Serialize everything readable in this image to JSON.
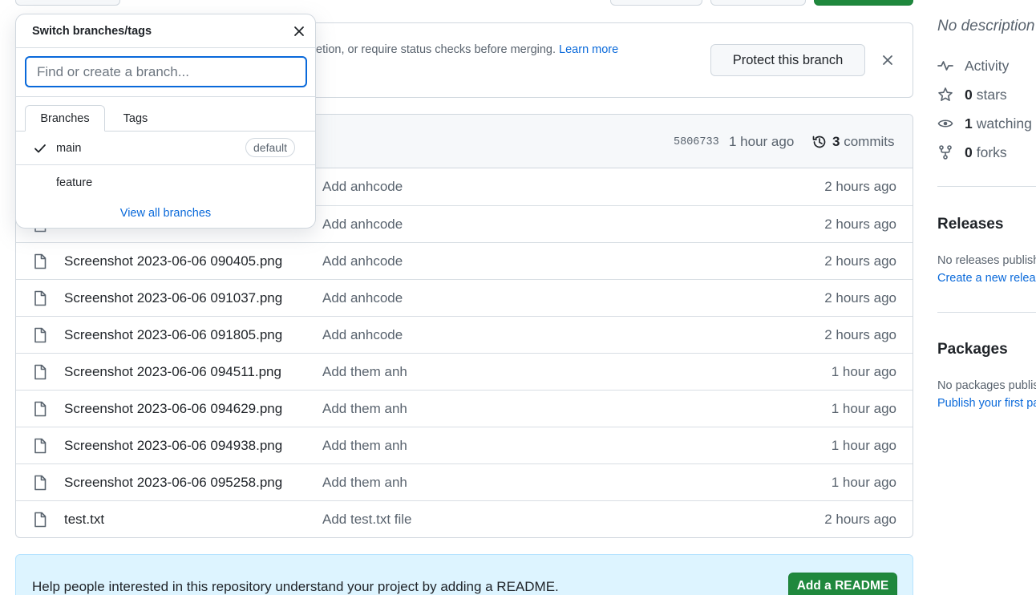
{
  "branch_popup": {
    "title": "Switch branches/tags",
    "search_placeholder": "Find or create a branch...",
    "tabs": [
      {
        "label": "Branches",
        "active": true
      },
      {
        "label": "Tags",
        "active": false
      }
    ],
    "branches": [
      {
        "name": "main",
        "selected": true,
        "badge": "default"
      },
      {
        "name": "feature",
        "selected": false,
        "badge": ""
      }
    ],
    "view_all_label": "View all branches"
  },
  "protect_banner": {
    "text": "etion, or require status checks before merging.",
    "learn_more": "Learn more",
    "button_label": "Protect this branch"
  },
  "latest_commit": {
    "sha": "5806733",
    "time": "1 hour ago",
    "commit_count": "3",
    "commits_label": "commits"
  },
  "files": [
    {
      "name": "",
      "message": "Add anhcode",
      "time": "2 hours ago"
    },
    {
      "name": "",
      "message": "Add anhcode",
      "time": "2 hours ago"
    },
    {
      "name": "Screenshot 2023-06-06 090405.png",
      "message": "Add anhcode",
      "time": "2 hours ago"
    },
    {
      "name": "Screenshot 2023-06-06 091037.png",
      "message": "Add anhcode",
      "time": "2 hours ago"
    },
    {
      "name": "Screenshot 2023-06-06 091805.png",
      "message": "Add anhcode",
      "time": "2 hours ago"
    },
    {
      "name": "Screenshot 2023-06-06 094511.png",
      "message": "Add them anh",
      "time": "1 hour ago"
    },
    {
      "name": "Screenshot 2023-06-06 094629.png",
      "message": "Add them anh",
      "time": "1 hour ago"
    },
    {
      "name": "Screenshot 2023-06-06 094938.png",
      "message": "Add them anh",
      "time": "1 hour ago"
    },
    {
      "name": "Screenshot 2023-06-06 095258.png",
      "message": "Add them anh",
      "time": "1 hour ago"
    },
    {
      "name": "test.txt",
      "message": "Add test.txt file",
      "time": "2 hours ago"
    }
  ],
  "readme_banner": {
    "text": "Help people interested in this repository understand your project by adding a README.",
    "button_label": "Add a README"
  },
  "sidebar": {
    "description": "No description",
    "stats": [
      {
        "icon": "pulse-icon",
        "count": "",
        "label": "Activity"
      },
      {
        "icon": "star-icon",
        "count": "0",
        "label": "stars"
      },
      {
        "icon": "eye-icon",
        "count": "1",
        "label": "watching"
      },
      {
        "icon": "fork-icon",
        "count": "0",
        "label": "forks"
      }
    ],
    "releases": {
      "heading": "Releases",
      "note": "No releases published",
      "link": "Create a new release"
    },
    "packages": {
      "heading": "Packages",
      "note": "No packages published",
      "link": "Publish your first package"
    }
  },
  "colors": {
    "accent": "#0969da",
    "green": "#1f883d",
    "border": "#d0d7de",
    "muted": "#59636e"
  }
}
